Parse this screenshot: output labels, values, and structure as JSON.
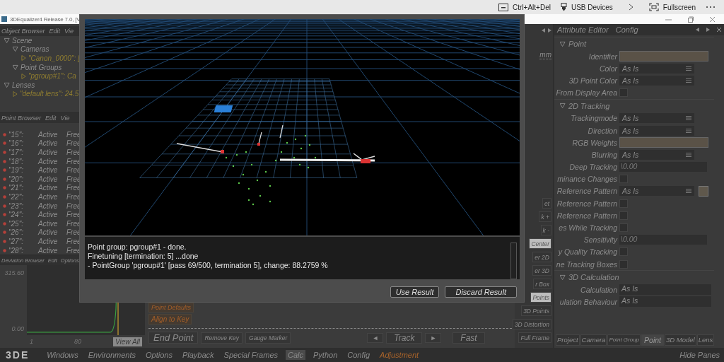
{
  "host_bar": {
    "items": [
      {
        "kind": "keyboard",
        "label": "Ctrl+Alt+Del"
      },
      {
        "kind": "usb",
        "label": "USB Devices"
      },
      {
        "kind": "chevron"
      },
      {
        "kind": "fullscreen",
        "label": "Fullscreen"
      },
      {
        "kind": "more"
      }
    ]
  },
  "window": {
    "title": "3DEqualizer4 Release 7.0, [V"
  },
  "object_browser": {
    "menu": [
      "Object Browser",
      "Edit",
      "Vie"
    ],
    "tree": [
      {
        "label": "Scene",
        "expanded": true,
        "children": [
          {
            "label": "Cameras",
            "expanded": true,
            "children": [
              {
                "label": "\"Canon_0000\": ["
              }
            ]
          },
          {
            "label": "Point Groups",
            "expanded": true,
            "children": [
              {
                "label": "\"pgroup#1\": Ca"
              }
            ]
          }
        ]
      },
      {
        "label": "Lenses",
        "expanded": true,
        "children": [
          {
            "label": "\"default lens\": 24.5"
          }
        ]
      }
    ]
  },
  "point_browser": {
    "menu": [
      "Point Browser",
      "Edit",
      "Vie"
    ],
    "rows": [
      {
        "name": "\"15\":",
        "status": "Active",
        "mode": "Free"
      },
      {
        "name": "\"16\":",
        "status": "Active",
        "mode": "Free"
      },
      {
        "name": "\"17\":",
        "status": "Active",
        "mode": "Free"
      },
      {
        "name": "\"18\":",
        "status": "Active",
        "mode": "Free"
      },
      {
        "name": "\"19\":",
        "status": "Active",
        "mode": "Free"
      },
      {
        "name": "\"20\":",
        "status": "Active",
        "mode": "Free"
      },
      {
        "name": "\"21\":",
        "status": "Active",
        "mode": "Free"
      },
      {
        "name": "\"22\":",
        "status": "Active",
        "mode": "Free"
      },
      {
        "name": "\"23\":",
        "status": "Active",
        "mode": "Free"
      },
      {
        "name": "\"24\":",
        "status": "Active",
        "mode": "Free"
      },
      {
        "name": "\"25\":",
        "status": "Active",
        "mode": "Free"
      },
      {
        "name": "\"26\":",
        "status": "Active",
        "mode": "Free"
      },
      {
        "name": "\"27\":",
        "status": "Active",
        "mode": "Free"
      },
      {
        "name": "\"28\":",
        "status": "Active",
        "mode": "Free"
      }
    ]
  },
  "deviation_browser": {
    "menu": [
      "Deviation Browser",
      "Edit",
      "Options"
    ],
    "y_labels": [
      "315.60",
      "0.00"
    ],
    "x_labels": [
      "1",
      "80"
    ],
    "button": "View All"
  },
  "dialog": {
    "console": [
      "Point group: pgroup#1 -  done.",
      "Finetuning [termination: 5] ...done",
      "- PointGroup 'pgroup#1'  [pass 69/500, termination 5], change: 88.2759 %"
    ],
    "buttons": [
      "Use Result",
      "Discard Result"
    ]
  },
  "tracking_controls": {
    "side_buttons": [
      "Point Defaults",
      "Align to Key"
    ],
    "buttons": [
      "End Point",
      "Remove Key",
      "Gauge Marker"
    ],
    "prev": "◄",
    "track": "Track",
    "next": "►",
    "speed": "Fast"
  },
  "side_strip": {
    "unit": "mm",
    "buttons": [
      {
        "label": "et",
        "on": false
      },
      {
        "label": "k +",
        "on": false
      },
      {
        "label": "k -",
        "on": false
      },
      {
        "label": "Center",
        "on": true
      },
      {
        "label": "er 2D",
        "on": false
      },
      {
        "label": "er 3D",
        "on": false
      },
      {
        "label": "r Box",
        "on": false
      },
      {
        "label": "Points",
        "on": true
      },
      {
        "label": "3D Points",
        "on": false
      },
      {
        "label": "3D Distortion",
        "on": false
      },
      {
        "label": "Full Frame",
        "on": false
      }
    ]
  },
  "attribute_editor": {
    "menu": [
      "Attribute Editor",
      "Config"
    ],
    "sections": [
      {
        "title": "Point",
        "expanded": true,
        "rows": [
          {
            "kind": "text",
            "label": "Identifier"
          },
          {
            "kind": "dropdown",
            "label": "Color",
            "value": "As Is"
          },
          {
            "kind": "dropdown",
            "label": "3D Point Color",
            "value": "As Is"
          },
          {
            "kind": "checkbox",
            "label": "From Display Area",
            "checked": false
          }
        ]
      },
      {
        "title": "2D Tracking",
        "expanded": true,
        "rows": [
          {
            "kind": "dropdown",
            "label": "Trackingmode",
            "value": "As Is"
          },
          {
            "kind": "dropdown",
            "label": "Direction",
            "value": "As Is"
          },
          {
            "kind": "text",
            "label": "RGB Weights"
          },
          {
            "kind": "dropdown",
            "label": "Blurring",
            "value": "As Is"
          },
          {
            "kind": "number",
            "label": "Deep Tracking",
            "value": "\\0.00"
          },
          {
            "kind": "checkbox",
            "label": "minance Changes",
            "checked": false
          },
          {
            "kind": "dropdown_swatch",
            "label": "Reference Pattern",
            "value": "As Is"
          },
          {
            "kind": "checkbox",
            "label": "Reference Pattern",
            "checked": false
          },
          {
            "kind": "checkbox",
            "label": "Reference Pattern",
            "checked": false
          },
          {
            "kind": "checkbox",
            "label": "es While Tracking",
            "checked": false
          },
          {
            "kind": "number",
            "label": "Sensitivity",
            "value": "\\0.00"
          },
          {
            "kind": "checkbox",
            "label": "y Quality Tracking",
            "checked": false
          },
          {
            "kind": "checkbox",
            "label": "ne Tracking Boxes",
            "checked": false
          }
        ]
      },
      {
        "title": "3D Calculation",
        "expanded": true,
        "rows": [
          {
            "kind": "field",
            "label": "Calculation",
            "value": "As Is"
          },
          {
            "kind": "field",
            "label": "ulation Behaviour",
            "value": "As Is"
          }
        ]
      }
    ],
    "tabs": [
      {
        "label": "Project",
        "selected": false
      },
      {
        "label": "Camera",
        "selected": false
      },
      {
        "label": "Point Group",
        "selected": false
      },
      {
        "label": "Point",
        "selected": true
      },
      {
        "label": "3D Model",
        "selected": false
      },
      {
        "label": "Lens",
        "selected": false
      }
    ]
  },
  "menu_bar": {
    "logo": "3DE",
    "items": [
      {
        "label": "Windows",
        "selected": false,
        "kind": "normal"
      },
      {
        "label": "Environments",
        "selected": false,
        "kind": "normal"
      },
      {
        "label": "Options",
        "selected": false,
        "kind": "normal"
      },
      {
        "label": "Playback",
        "selected": false,
        "kind": "normal"
      },
      {
        "label": "Special Frames",
        "selected": false,
        "kind": "normal"
      },
      {
        "label": "Calc",
        "selected": true,
        "kind": "normal"
      },
      {
        "label": "Python",
        "selected": false,
        "kind": "normal"
      },
      {
        "label": "Config",
        "selected": false,
        "kind": "normal"
      },
      {
        "label": "Adjustment",
        "selected": false,
        "kind": "accent"
      }
    ],
    "hide_panes": "Hide Panes"
  }
}
